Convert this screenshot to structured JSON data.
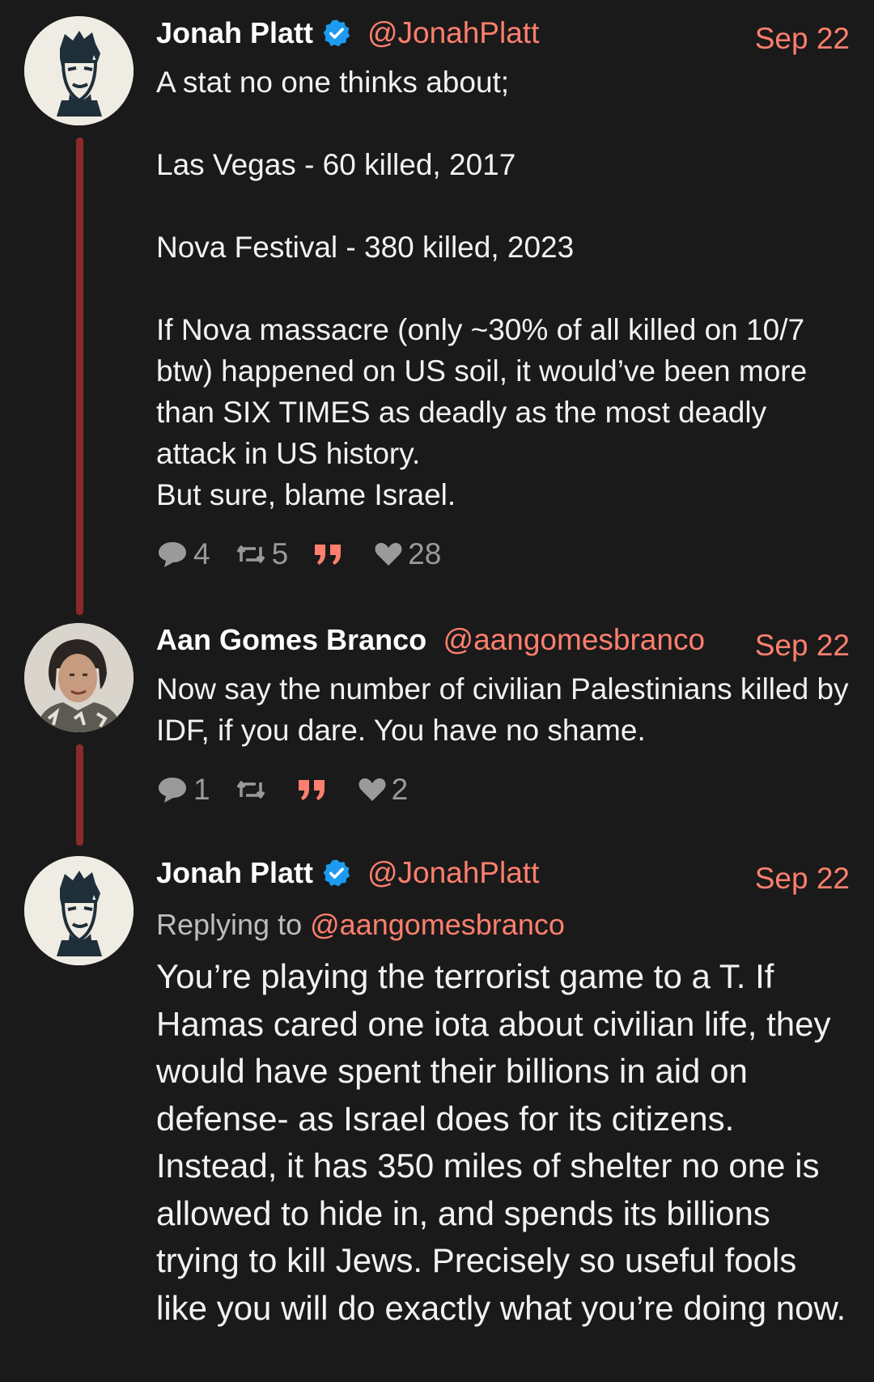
{
  "posts": [
    {
      "display_name": "Jonah Platt",
      "verified": true,
      "handle": "@JonahPlatt",
      "date": "Sep 22",
      "avatar_icon": "illustrated-face-avatar",
      "text": "A stat no one thinks about;\n\nLas Vegas - 60 killed, 2017\n\nNova Festival - 380 killed, 2023\n\nIf Nova massacre (only ~30% of all killed on 10/7 btw) happened on US soil, it would’ve been more than SIX TIMES as deadly as the most deadly attack in US history.\nBut sure, blame Israel.",
      "stats": {
        "replies": "4",
        "reposts": "5",
        "quotes": "",
        "likes": "28"
      }
    },
    {
      "display_name": "Aan Gomes Branco",
      "verified": false,
      "handle": "@aangomesbranco",
      "date": "Sep 22",
      "avatar_icon": "photo-avatar",
      "text": "Now say the number of civilian Palestinians killed by IDF, if you dare. You have no shame.",
      "stats": {
        "replies": "1",
        "reposts": "",
        "quotes": "",
        "likes": "2"
      }
    },
    {
      "display_name": "Jonah Platt",
      "verified": true,
      "handle": "@JonahPlatt",
      "date": "Sep 22",
      "avatar_icon": "illustrated-face-avatar",
      "replying_to_prefix": "Replying to",
      "replying_to_handle": "@aangomesbranco",
      "text": "You’re playing the terrorist game to a T. If Hamas cared one iota about civilian life, they would have spent their billions in aid on defense- as Israel does for its citizens. Instead, it has 350 miles of shelter no one is allowed to hide in, and spends its billions trying to kill Jews. Precisely so useful fools like you will do exactly what you’re doing now."
    }
  ],
  "icons": {
    "verified": "verified-badge-icon",
    "reply": "reply-bubble-icon",
    "repost": "repost-icon",
    "quote": "quote-icon",
    "like": "heart-icon"
  },
  "colors": {
    "background": "#1a1a1a",
    "accent": "#ff7f6e",
    "thread_line": "#8b2a2a",
    "verified": "#1d9bf0",
    "muted": "#9a9a9a"
  }
}
